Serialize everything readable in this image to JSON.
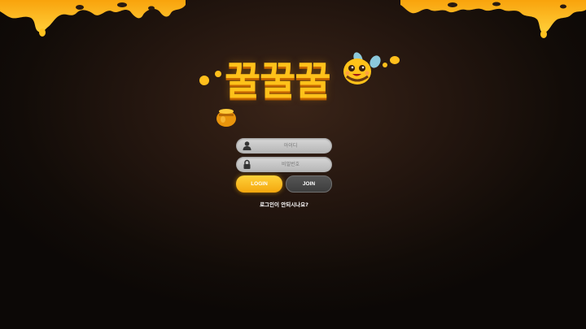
{
  "logo": {
    "text": "꿀꿀꿀"
  },
  "login_form": {
    "id_placeholder": "아이디",
    "password_placeholder": "비밀번호",
    "login_label": "LOGIN",
    "join_label": "JOIN",
    "help_link": "로그인이 안되시나요?"
  },
  "icons": {
    "user": "user-icon",
    "lock": "lock-icon",
    "bee": "bee-mascot",
    "honey_pot": "honey-pot-icon"
  },
  "colors": {
    "honey": "#f7b515",
    "login_button": "#f3a60e",
    "join_button": "#444444",
    "background": "#1a110c"
  }
}
